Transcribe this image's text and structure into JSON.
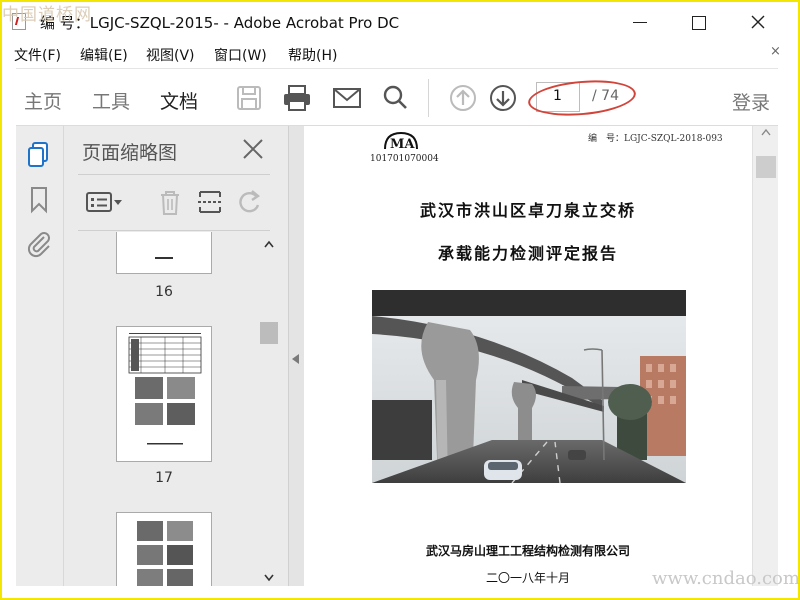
{
  "watermark": {
    "top": "中国道桥网",
    "bottom": "www.cndao.com"
  },
  "window": {
    "title": "编 号：LGJC-SZQL-2015- - Adobe Acrobat Pro DC"
  },
  "menu": {
    "items": [
      "文件(F)",
      "编辑(E)",
      "视图(V)",
      "窗口(W)",
      "帮助(H)"
    ],
    "close": "×"
  },
  "toolbar": {
    "tabs": [
      "主页",
      "工具",
      "文档"
    ],
    "page_current": "1",
    "page_total": "/ 74",
    "login": "登录",
    "icons": [
      "save-icon",
      "print-icon",
      "email-icon",
      "search-icon",
      "page-up-icon",
      "page-down-icon"
    ]
  },
  "left_rail": {
    "icons": [
      "page-thumbnails-icon",
      "bookmark-icon",
      "attachment-icon"
    ]
  },
  "thumbnails_panel": {
    "title": "页面缩略图",
    "pages": [
      {
        "number": "16"
      },
      {
        "number": "17"
      }
    ]
  },
  "document": {
    "seal": "MA",
    "seal_number": "101701070004",
    "doc_number": "编　号：LGJC-SZQL-2018-093",
    "title_line1": "武汉市洪山区卓刀泉立交桥",
    "title_line2": "承载能力检测评定报告",
    "organization": "武汉马房山理工工程结构检测有限公司",
    "date": "二〇一八年十月"
  },
  "colors": {
    "highlight_ring": "#d2443a",
    "watermark_border": "#f3e600"
  }
}
